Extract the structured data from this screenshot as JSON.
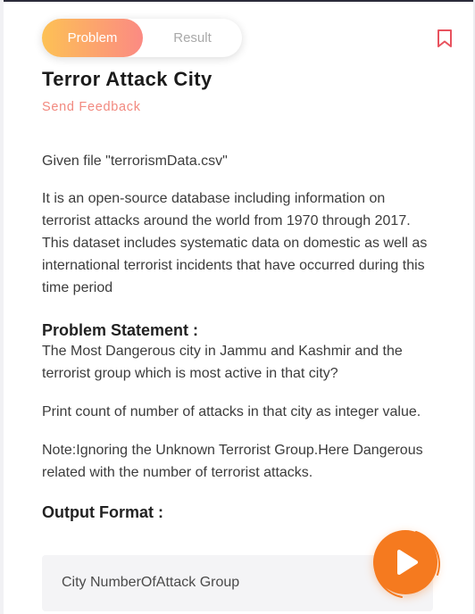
{
  "tabs": {
    "problem_label": "Problem",
    "result_label": "Result"
  },
  "header": {
    "title": "Terror Attack City",
    "feedback_link": "Send Feedback"
  },
  "problem": {
    "given_file": "Given file \"terrorismData.csv\"",
    "description": "It is an open-source database including information on terrorist attacks around the world from 1970 through 2017. This dataset includes systematic data on domestic as well as international terrorist incidents that have occurred during this time period",
    "statement_heading": "Problem Statement :",
    "statement_text": "The Most Dangerous city in Jammu and Kashmir and the terrorist group which is most active in that city?",
    "print_instruction": "Print count of number of attacks in that city as integer value.",
    "note": "Note:Ignoring the Unknown Terrorist Group.Here Dangerous related with the number of terrorist attacks.",
    "output_heading": "Output Format :",
    "output_format": "City NumberOfAttack Group"
  },
  "icons": {
    "bookmark": "bookmark-icon",
    "run": "play-icon"
  },
  "colors": {
    "tab_gradient_start": "#fdc155",
    "tab_gradient_end": "#fb8a83",
    "feedback": "#f2897f",
    "bookmark": "#e8525e",
    "run_button": "#f57a1f"
  }
}
